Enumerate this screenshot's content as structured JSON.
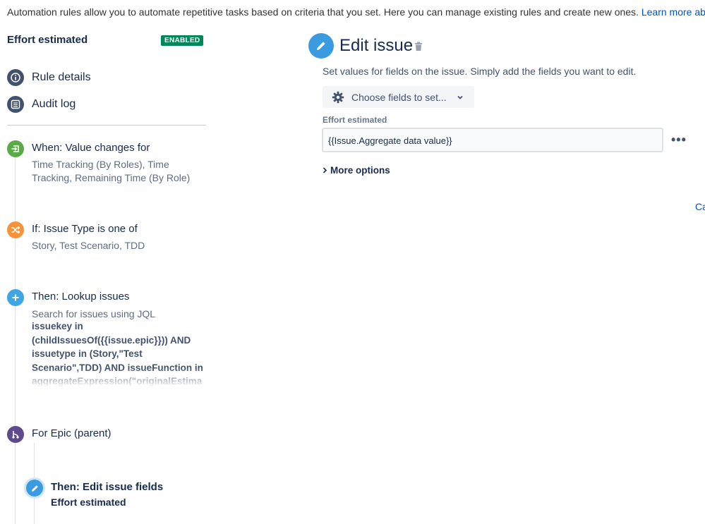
{
  "intro": {
    "text": "Automation rules allow you to automate repetitive tasks based on criteria that you set. Here you can manage existing rules and create new ones. ",
    "link": "Learn more about a"
  },
  "rule": {
    "title": "Effort estimated",
    "status": "ENABLED"
  },
  "nav": {
    "details": "Rule details",
    "audit": "Audit log"
  },
  "steps": {
    "trigger": {
      "title": "When: Value changes for",
      "subtitle": "Time Tracking (By Roles), Time Tracking, Remaining Time (By Role)",
      "color": "#5aab47"
    },
    "condition": {
      "title": "If: Issue Type is one of",
      "subtitle": "Story, Test Scenario, TDD",
      "color": "#f6923a"
    },
    "lookup": {
      "title": "Then: Lookup issues",
      "subtitle": "Search for issues using JQL",
      "jql": "issuekey in (childIssuesOf({{issue.epic}})) AND issuetype in (Story,\"Test Scenario\",TDD) AND issueFunction in aggregateExpression(\"originalEstima",
      "color": "#3fa6e3"
    },
    "branch": {
      "title": "For Epic (parent)",
      "color": "#5e4a8c"
    },
    "edit": {
      "title": "Then: Edit issue fields",
      "subtitle": "Effort estimated",
      "color": "#3b9be0"
    }
  },
  "panel": {
    "title": "Edit issue",
    "description": "Set values for fields on the issue. Simply add the fields you want to edit.",
    "choose_fields": "Choose fields to set...",
    "field_label": "Effort estimated",
    "field_value": "{{Issue.Aggregate data value}}",
    "more_options": "More options",
    "cancel": "Ca"
  }
}
